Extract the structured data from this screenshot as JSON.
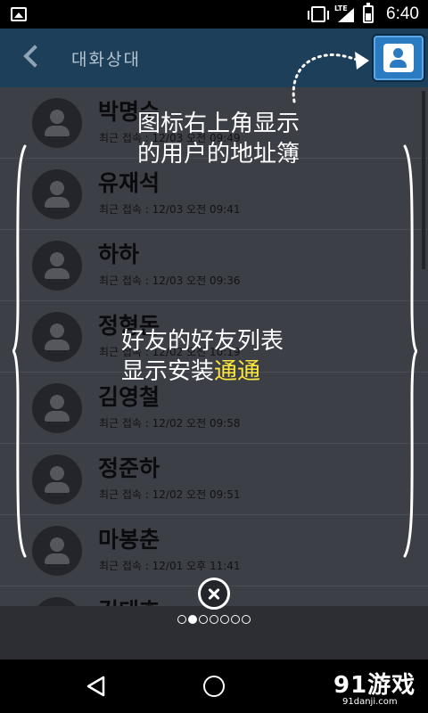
{
  "status_bar": {
    "network": "LTE",
    "time": "6:40"
  },
  "app_bar": {
    "title": "대화상대"
  },
  "contacts": [
    {
      "name": "박명수",
      "last_access": "최근 접속 : 12/03  오전 09:49"
    },
    {
      "name": "유재석",
      "last_access": "최근 접속 : 12/03  오전 09:41"
    },
    {
      "name": "하하",
      "last_access": "최근 접속 : 12/03  오전 09:36"
    },
    {
      "name": "정형돈",
      "last_access": "최근 접속 : 12/02  오전 10:19"
    },
    {
      "name": "김영철",
      "last_access": "최근 접속 : 12/02  오전 09:58"
    },
    {
      "name": "정준하",
      "last_access": "최근 접속 : 12/02  오전 09:51"
    },
    {
      "name": "마봉춘",
      "last_access": "최근 접속 : 12/01  오후 11:41"
    },
    {
      "name": "김태호",
      "last_access": ""
    }
  ],
  "overlay": {
    "hint_top_line1": "图标右上角显示",
    "hint_top_line2": "的用户的地址簿",
    "hint_mid_line1": "好友的好友列表",
    "hint_mid_line2_prefix": "显示安装",
    "hint_mid_line2_highlight": "通通",
    "highlight_color": "#ffe83b",
    "page_count": 7,
    "active_page": 2
  },
  "watermark": {
    "brand": "91游戏",
    "url": "91danji.com"
  },
  "colors": {
    "app_bar": "#1d3f5a",
    "accent": "#2a7bc2"
  }
}
